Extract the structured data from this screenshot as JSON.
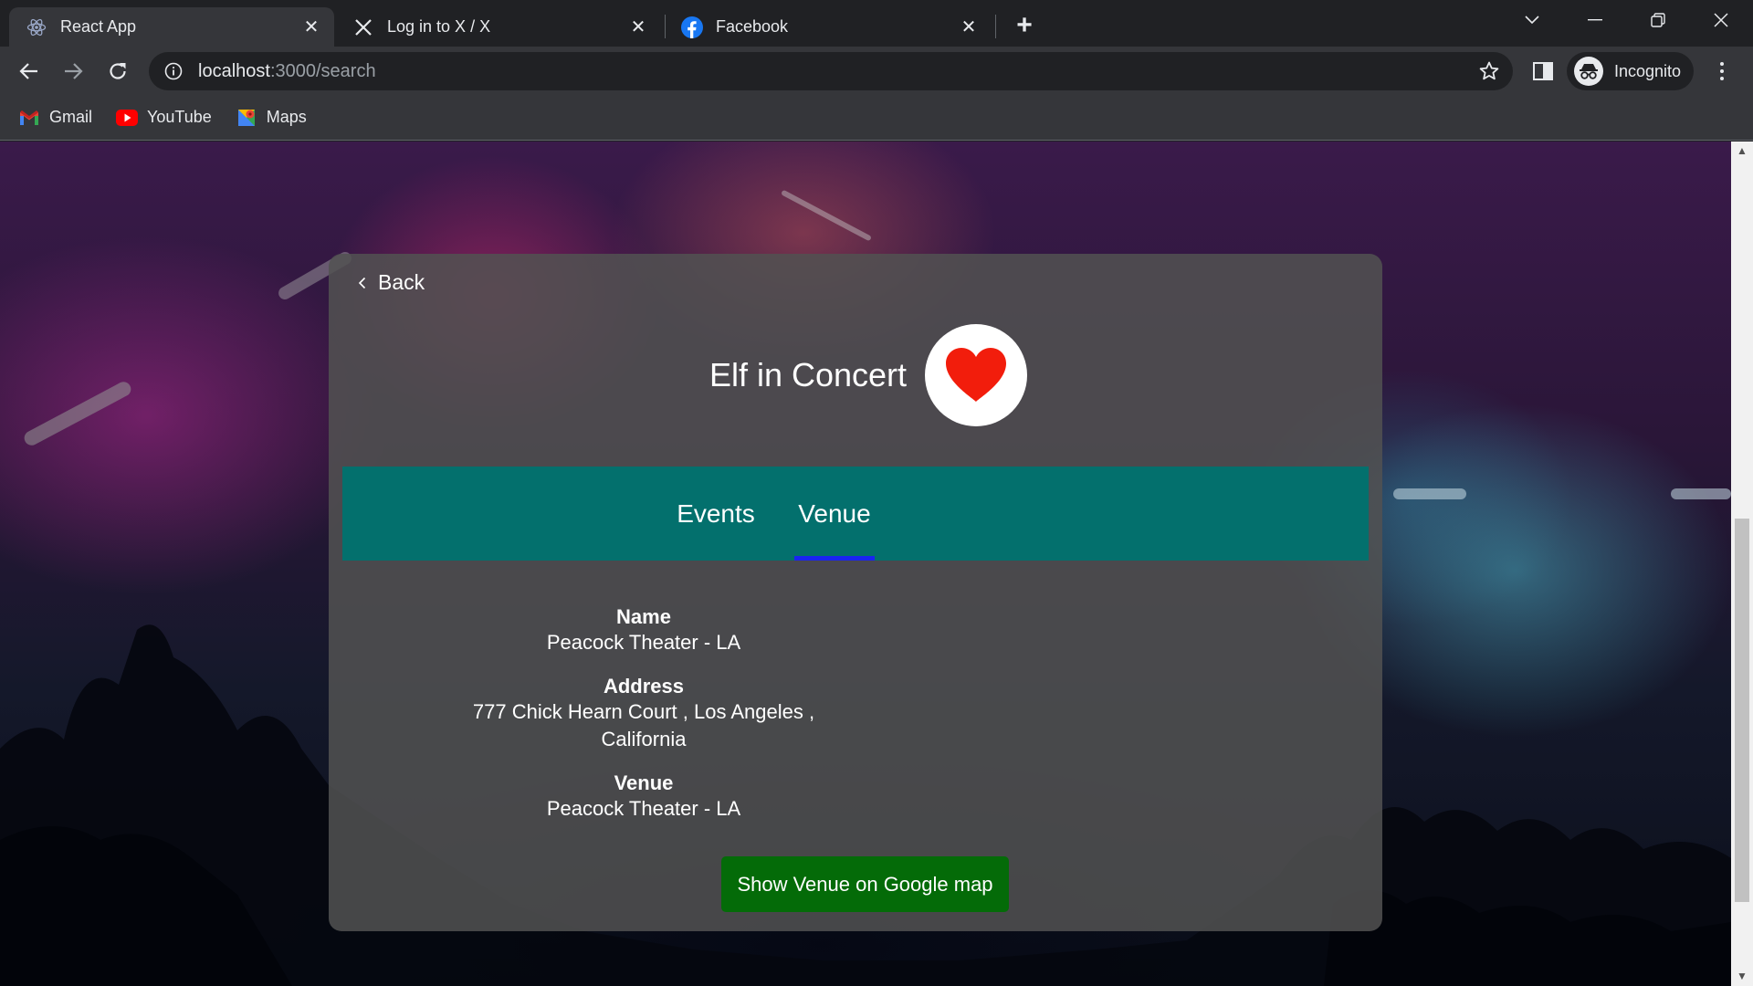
{
  "browser": {
    "tabs": [
      {
        "title": "React App",
        "favicon": "react-icon",
        "active": true
      },
      {
        "title": "Log in to X / X",
        "favicon": "x-logo-icon",
        "active": false
      },
      {
        "title": "Facebook",
        "favicon": "facebook-icon",
        "active": false
      }
    ],
    "url_host": "localhost",
    "url_path": ":3000/search",
    "profile_label": "Incognito",
    "bookmarks": [
      {
        "label": "Gmail",
        "icon": "gmail-icon"
      },
      {
        "label": "YouTube",
        "icon": "youtube-icon"
      },
      {
        "label": "Maps",
        "icon": "maps-icon"
      }
    ]
  },
  "page": {
    "back_label": "Back",
    "event_title": "Elf in Concert",
    "favorite": true,
    "tabs": [
      {
        "label": "Events",
        "active": false
      },
      {
        "label": "Venue",
        "active": true
      }
    ],
    "venue": {
      "name_label": "Name",
      "name_value": "Peacock Theater - LA",
      "address_label": "Address",
      "address_line1": "777 Chick Hearn Court , Los Angeles ,",
      "address_line2": "California",
      "venue_label": "Venue",
      "venue_value": "Peacock Theater - LA"
    },
    "map_button_label": "Show Venue on Google map"
  },
  "colors": {
    "tab_bar": "#03706d",
    "tab_underline": "#1a24f0",
    "map_button": "#046b08",
    "heart": "#f21d0c"
  }
}
